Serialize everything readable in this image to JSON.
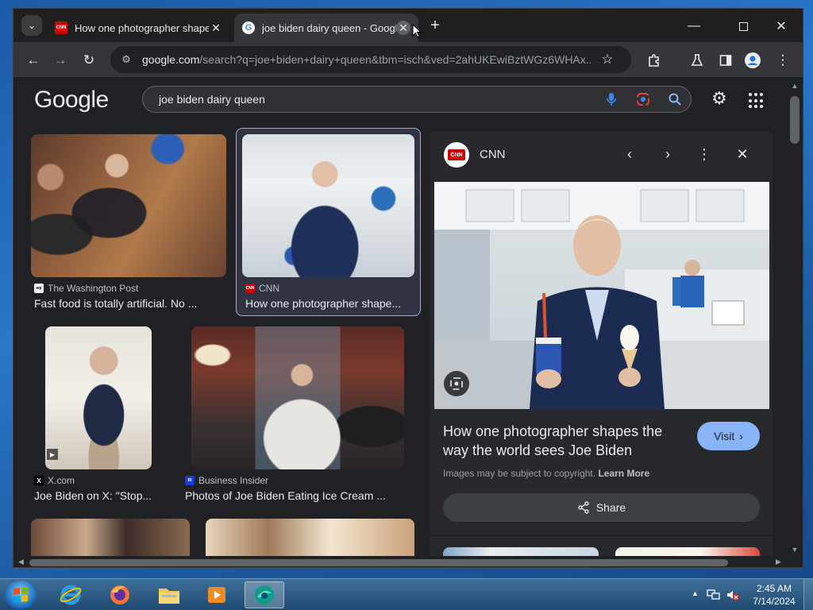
{
  "browser": {
    "tabs": [
      {
        "title": "How one photographer shapes the way the world sees Joe Biden",
        "favicon": "cnn-favicon",
        "active": false
      },
      {
        "title": "joe biden dairy queen - Google Search",
        "favicon": "google-favicon",
        "active": true
      }
    ],
    "address": {
      "host": "google.com",
      "path": "/search?q=joe+biden+dairy+queen&tbm=isch&ved=2ahUKEwiBztWGz6WHAx..."
    }
  },
  "google": {
    "logo": "Google",
    "query": "joe biden dairy queen"
  },
  "results": [
    {
      "source": "The Washington Post",
      "caption": "Fast food is totally artificial. No ...",
      "favicon_text": "wp"
    },
    {
      "source": "CNN",
      "caption": "How one photographer shape...",
      "favicon_text": "CNN"
    },
    {
      "source": "X.com",
      "caption": "Joe Biden on X: \"Stop...",
      "favicon_text": "X"
    },
    {
      "source": "Business Insider",
      "caption": "Photos of Joe Biden Eating Ice Cream ...",
      "favicon_text": "BI"
    }
  ],
  "panel": {
    "source": "CNN",
    "logo_text": "CNN",
    "title": "How one photographer shapes the way the world sees Joe Biden",
    "visit_label": "Visit",
    "copyright": "Images may be subject to copyright.",
    "learn_more": "Learn More",
    "share_label": "Share"
  },
  "taskbar": {
    "time": "2:45 AM",
    "date": "7/14/2024"
  },
  "colors": {
    "accent": "#8ab4f8",
    "background": "#202124",
    "panel": "#28292c",
    "cnn_red": "#cc0000"
  }
}
